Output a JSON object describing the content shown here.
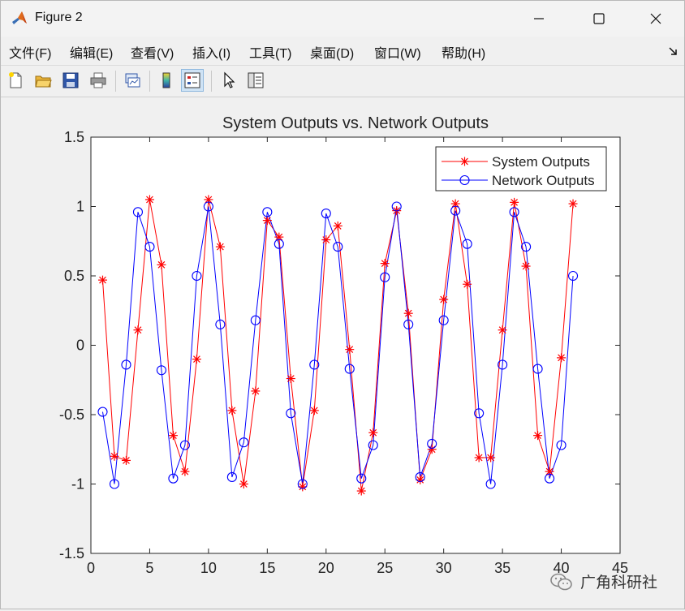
{
  "window": {
    "title": "Figure 2",
    "buttons": [
      "minimize",
      "maximize",
      "close"
    ]
  },
  "menu": [
    "文件(F)",
    "编辑(E)",
    "查看(V)",
    "插入(I)",
    "工具(T)",
    "桌面(D)",
    "窗口(W)",
    "帮助(H)"
  ],
  "toolbar": {
    "icons": [
      "new-figure-icon",
      "open-file-icon",
      "save-icon",
      "print-icon",
      "link-plot-icon",
      "colorbar-icon",
      "legend-icon",
      "pointer-icon",
      "property-editor-icon"
    ],
    "active": "legend-icon"
  },
  "chart_data": {
    "type": "line",
    "title": "System Outputs vs. Network Outputs",
    "xlabel": "",
    "ylabel": "",
    "xlim": [
      0,
      45
    ],
    "ylim": [
      -1.5,
      1.5
    ],
    "xticks": [
      0,
      5,
      10,
      15,
      20,
      25,
      30,
      35,
      40,
      45
    ],
    "yticks": [
      1.5,
      1,
      0.5,
      0,
      -0.5,
      -1,
      -1.5
    ],
    "xtick_labels": [
      "0",
      "5",
      "10",
      "15",
      "20",
      "25",
      "30",
      "35",
      "40",
      "45"
    ],
    "ytick_labels": [
      "1.5",
      "1",
      "0.5",
      "0",
      "-0.5",
      "-1",
      "-1.5"
    ],
    "grid": false,
    "legend_position": "top-right",
    "x": [
      1,
      2,
      3,
      4,
      5,
      6,
      7,
      8,
      9,
      10,
      11,
      12,
      13,
      14,
      15,
      16,
      17,
      18,
      19,
      20,
      21,
      22,
      23,
      24,
      25,
      26,
      27,
      28,
      29,
      30,
      31,
      32,
      33,
      34,
      35,
      36,
      37,
      38,
      39,
      40,
      41
    ],
    "series": [
      {
        "name": "System Outputs",
        "color": "#ff0000",
        "marker": "asterisk",
        "values": [
          0.47,
          -0.8,
          -0.83,
          0.11,
          1.05,
          0.58,
          -0.65,
          -0.91,
          -0.1,
          1.05,
          0.71,
          -0.47,
          -1.0,
          -0.33,
          0.9,
          0.78,
          -0.24,
          -1.02,
          -0.47,
          0.76,
          0.86,
          -0.03,
          -1.05,
          -0.63,
          0.59,
          0.97,
          0.23,
          -0.97,
          -0.75,
          0.33,
          1.02,
          0.44,
          -0.81,
          -0.81,
          0.11,
          1.03,
          0.57,
          -0.65,
          -0.91,
          -0.09,
          1.02
        ]
      },
      {
        "name": "Network Outputs",
        "color": "#0000ff",
        "marker": "circle",
        "values": [
          -0.48,
          -1.0,
          -0.14,
          0.96,
          0.71,
          -0.18,
          -0.96,
          -0.72,
          0.5,
          1.0,
          0.15,
          -0.95,
          -0.7,
          0.18,
          0.96,
          0.73,
          -0.49,
          -1.0,
          -0.14,
          0.95,
          0.71,
          -0.17,
          -0.96,
          -0.72,
          0.49,
          1.0,
          0.15,
          -0.95,
          -0.71,
          0.18,
          0.97,
          0.73,
          -0.49,
          -1.0,
          -0.14,
          0.96,
          0.71,
          -0.17,
          -0.96,
          -0.72,
          0.5
        ]
      }
    ]
  },
  "watermark": {
    "text": "广角科研社"
  }
}
